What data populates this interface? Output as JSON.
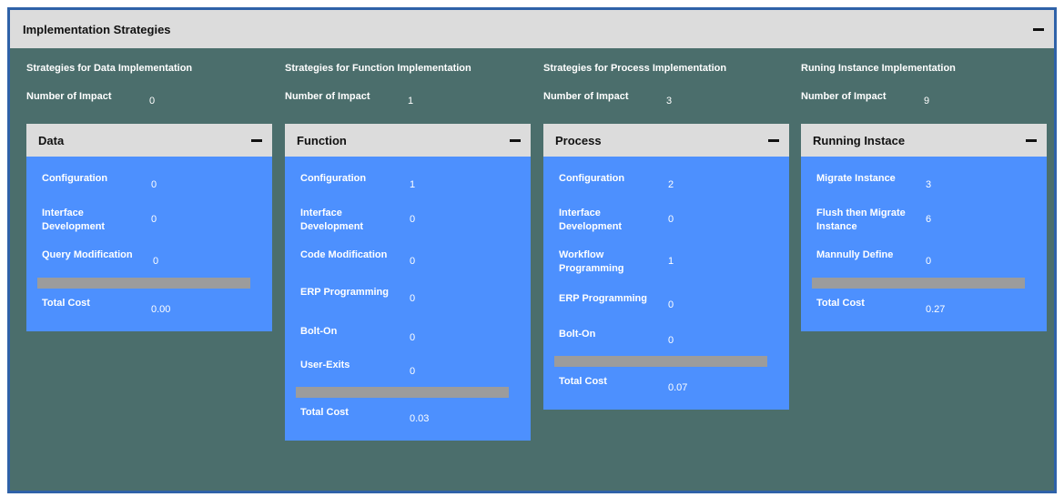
{
  "panel": {
    "title": "Implementation Strategies"
  },
  "columns": [
    {
      "heading": "Strategies for Data Implementation",
      "impact_label": "Number of Impact",
      "impact_value": "0",
      "card": {
        "title": "Data",
        "rows": [
          {
            "label": "Configuration",
            "value": "0"
          },
          {
            "label": "Interface Development",
            "value": "0"
          },
          {
            "label": "Query Modification",
            "value": "0"
          }
        ],
        "total_label": "Total Cost",
        "total_value": "0.00"
      }
    },
    {
      "heading": "Strategies for Function Implementation",
      "impact_label": "Number of Impact",
      "impact_value": "1",
      "card": {
        "title": "Function",
        "rows": [
          {
            "label": "Configuration",
            "value": "1"
          },
          {
            "label": "Interface Development",
            "value": "0"
          },
          {
            "label": "Code Modification",
            "value": "0"
          },
          {
            "label": "ERP Programming",
            "value": "0"
          },
          {
            "label": "Bolt-On",
            "value": "0"
          },
          {
            "label": "User-Exits",
            "value": "0"
          }
        ],
        "total_label": "Total Cost",
        "total_value": "0.03"
      }
    },
    {
      "heading": "Strategies for Process Implementation",
      "impact_label": "Number of Impact",
      "impact_value": "3",
      "card": {
        "title": "Process",
        "rows": [
          {
            "label": "Configuration",
            "value": "2"
          },
          {
            "label": "Interface Development",
            "value": "0"
          },
          {
            "label": "Workflow Programming",
            "value": "1"
          },
          {
            "label": "ERP Programming",
            "value": "0"
          },
          {
            "label": "Bolt-On",
            "value": "0"
          }
        ],
        "total_label": "Total Cost",
        "total_value": "0.07"
      }
    },
    {
      "heading": "Runing Instance Implementation",
      "impact_label": "Number of Impact",
      "impact_value": "9",
      "card": {
        "title": "Running Instace",
        "rows": [
          {
            "label": "Migrate Instance",
            "value": "3"
          },
          {
            "label": "Flush then Migrate Instance",
            "value": "6"
          },
          {
            "label": "Mannully Define",
            "value": "0"
          }
        ],
        "total_label": "Total Cost",
        "total_value": "0.27"
      }
    }
  ]
}
